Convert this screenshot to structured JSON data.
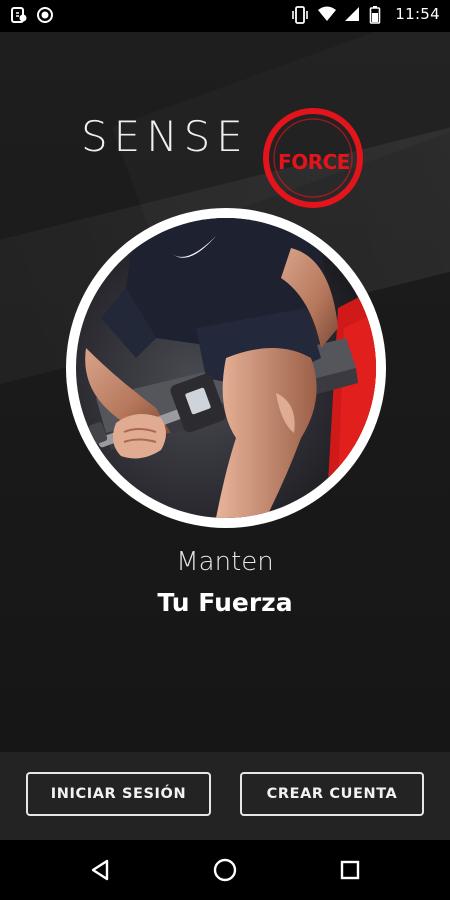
{
  "status_bar": {
    "time": "11:54",
    "left_icons": [
      "bug-report-icon",
      "record-circle-icon"
    ],
    "right_icons": [
      "vibrate-icon",
      "wifi-icon",
      "signal-icon",
      "battery-icon"
    ]
  },
  "logo": {
    "sense_text": "SENSE",
    "force_text": "FORCE",
    "accent_color": "#e3141c"
  },
  "hero": {
    "image": "person-lifting-dumbbell-photo"
  },
  "tagline": {
    "line1": "Manten",
    "line2": "Tu Fuerza"
  },
  "actions": {
    "login_label": "INICIAR SESIÓN",
    "create_label": "CREAR CUENTA"
  },
  "nav": {
    "icons": [
      "back-icon",
      "home-icon",
      "recents-icon"
    ]
  }
}
